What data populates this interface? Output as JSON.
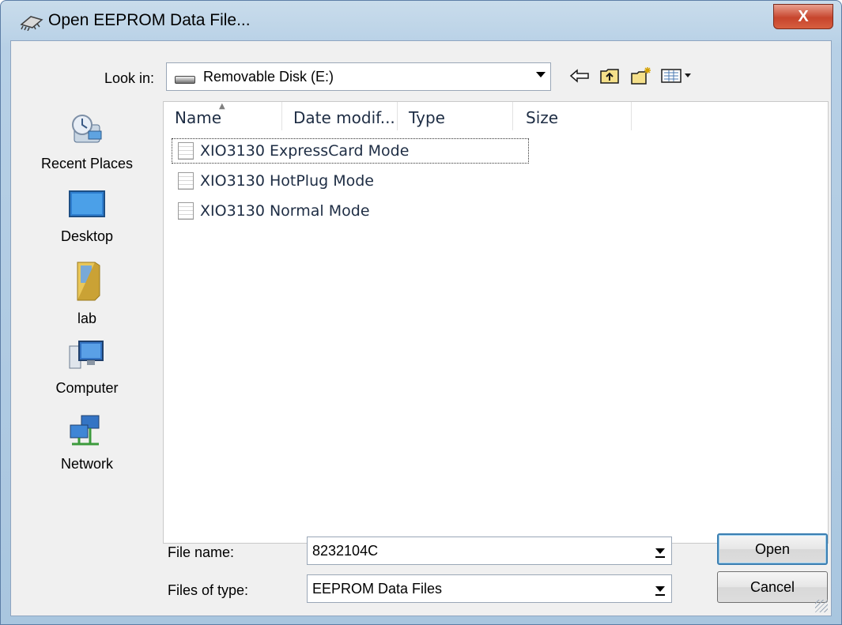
{
  "window": {
    "title": "Open EEPROM Data File...",
    "close_label": "X"
  },
  "lookin": {
    "label": "Look in:",
    "value": "Removable Disk (E:)"
  },
  "toolbar": {
    "icons": [
      "back-arrow-icon",
      "up-folder-icon",
      "new-folder-icon",
      "view-menu-icon"
    ]
  },
  "places": [
    {
      "label": "Recent Places",
      "icon": "recent-places-icon"
    },
    {
      "label": "Desktop",
      "icon": "desktop-icon"
    },
    {
      "label": "lab",
      "icon": "user-folder-icon"
    },
    {
      "label": "Computer",
      "icon": "computer-icon"
    },
    {
      "label": "Network",
      "icon": "network-icon"
    }
  ],
  "columns": [
    "Name",
    "Date modif...",
    "Type",
    "Size"
  ],
  "files": [
    {
      "name": "XIO3130 ExpressCard Mode",
      "focused": true
    },
    {
      "name": "XIO3130 HotPlug Mode",
      "focused": false
    },
    {
      "name": "XIO3130 Normal Mode",
      "focused": false
    }
  ],
  "filename": {
    "label": "File name:",
    "value": "8232104C"
  },
  "filetype": {
    "label": "Files of type:",
    "value": "EEPROM Data Files"
  },
  "buttons": {
    "open": "Open",
    "cancel": "Cancel"
  },
  "colors": {
    "title_bar": "#b7d0e6",
    "close_button": "#c7452d",
    "dialog_bg": "#f0f0f0",
    "list_text": "#1e2d44"
  }
}
